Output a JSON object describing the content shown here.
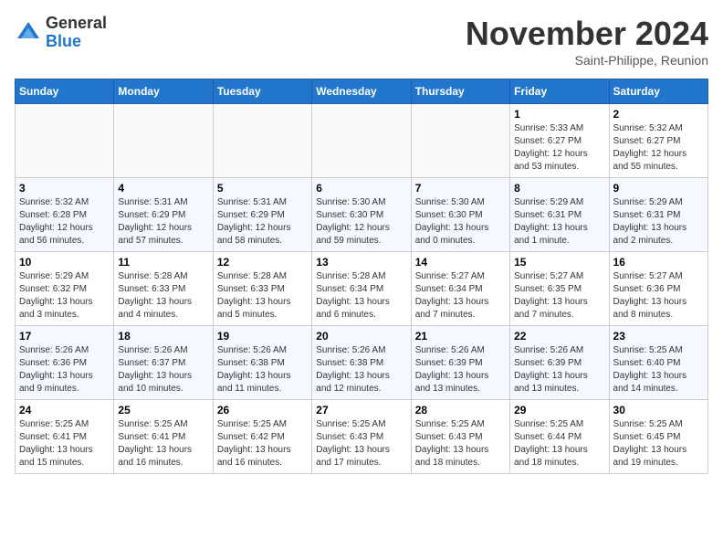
{
  "header": {
    "logo_general": "General",
    "logo_blue": "Blue",
    "month_title": "November 2024",
    "subtitle": "Saint-Philippe, Reunion"
  },
  "weekdays": [
    "Sunday",
    "Monday",
    "Tuesday",
    "Wednesday",
    "Thursday",
    "Friday",
    "Saturday"
  ],
  "weeks": [
    [
      {
        "day": "",
        "info": ""
      },
      {
        "day": "",
        "info": ""
      },
      {
        "day": "",
        "info": ""
      },
      {
        "day": "",
        "info": ""
      },
      {
        "day": "",
        "info": ""
      },
      {
        "day": "1",
        "info": "Sunrise: 5:33 AM\nSunset: 6:27 PM\nDaylight: 12 hours and 53 minutes."
      },
      {
        "day": "2",
        "info": "Sunrise: 5:32 AM\nSunset: 6:27 PM\nDaylight: 12 hours and 55 minutes."
      }
    ],
    [
      {
        "day": "3",
        "info": "Sunrise: 5:32 AM\nSunset: 6:28 PM\nDaylight: 12 hours and 56 minutes."
      },
      {
        "day": "4",
        "info": "Sunrise: 5:31 AM\nSunset: 6:29 PM\nDaylight: 12 hours and 57 minutes."
      },
      {
        "day": "5",
        "info": "Sunrise: 5:31 AM\nSunset: 6:29 PM\nDaylight: 12 hours and 58 minutes."
      },
      {
        "day": "6",
        "info": "Sunrise: 5:30 AM\nSunset: 6:30 PM\nDaylight: 12 hours and 59 minutes."
      },
      {
        "day": "7",
        "info": "Sunrise: 5:30 AM\nSunset: 6:30 PM\nDaylight: 13 hours and 0 minutes."
      },
      {
        "day": "8",
        "info": "Sunrise: 5:29 AM\nSunset: 6:31 PM\nDaylight: 13 hours and 1 minute."
      },
      {
        "day": "9",
        "info": "Sunrise: 5:29 AM\nSunset: 6:31 PM\nDaylight: 13 hours and 2 minutes."
      }
    ],
    [
      {
        "day": "10",
        "info": "Sunrise: 5:29 AM\nSunset: 6:32 PM\nDaylight: 13 hours and 3 minutes."
      },
      {
        "day": "11",
        "info": "Sunrise: 5:28 AM\nSunset: 6:33 PM\nDaylight: 13 hours and 4 minutes."
      },
      {
        "day": "12",
        "info": "Sunrise: 5:28 AM\nSunset: 6:33 PM\nDaylight: 13 hours and 5 minutes."
      },
      {
        "day": "13",
        "info": "Sunrise: 5:28 AM\nSunset: 6:34 PM\nDaylight: 13 hours and 6 minutes."
      },
      {
        "day": "14",
        "info": "Sunrise: 5:27 AM\nSunset: 6:34 PM\nDaylight: 13 hours and 7 minutes."
      },
      {
        "day": "15",
        "info": "Sunrise: 5:27 AM\nSunset: 6:35 PM\nDaylight: 13 hours and 7 minutes."
      },
      {
        "day": "16",
        "info": "Sunrise: 5:27 AM\nSunset: 6:36 PM\nDaylight: 13 hours and 8 minutes."
      }
    ],
    [
      {
        "day": "17",
        "info": "Sunrise: 5:26 AM\nSunset: 6:36 PM\nDaylight: 13 hours and 9 minutes."
      },
      {
        "day": "18",
        "info": "Sunrise: 5:26 AM\nSunset: 6:37 PM\nDaylight: 13 hours and 10 minutes."
      },
      {
        "day": "19",
        "info": "Sunrise: 5:26 AM\nSunset: 6:38 PM\nDaylight: 13 hours and 11 minutes."
      },
      {
        "day": "20",
        "info": "Sunrise: 5:26 AM\nSunset: 6:38 PM\nDaylight: 13 hours and 12 minutes."
      },
      {
        "day": "21",
        "info": "Sunrise: 5:26 AM\nSunset: 6:39 PM\nDaylight: 13 hours and 13 minutes."
      },
      {
        "day": "22",
        "info": "Sunrise: 5:26 AM\nSunset: 6:39 PM\nDaylight: 13 hours and 13 minutes."
      },
      {
        "day": "23",
        "info": "Sunrise: 5:25 AM\nSunset: 6:40 PM\nDaylight: 13 hours and 14 minutes."
      }
    ],
    [
      {
        "day": "24",
        "info": "Sunrise: 5:25 AM\nSunset: 6:41 PM\nDaylight: 13 hours and 15 minutes."
      },
      {
        "day": "25",
        "info": "Sunrise: 5:25 AM\nSunset: 6:41 PM\nDaylight: 13 hours and 16 minutes."
      },
      {
        "day": "26",
        "info": "Sunrise: 5:25 AM\nSunset: 6:42 PM\nDaylight: 13 hours and 16 minutes."
      },
      {
        "day": "27",
        "info": "Sunrise: 5:25 AM\nSunset: 6:43 PM\nDaylight: 13 hours and 17 minutes."
      },
      {
        "day": "28",
        "info": "Sunrise: 5:25 AM\nSunset: 6:43 PM\nDaylight: 13 hours and 18 minutes."
      },
      {
        "day": "29",
        "info": "Sunrise: 5:25 AM\nSunset: 6:44 PM\nDaylight: 13 hours and 18 minutes."
      },
      {
        "day": "30",
        "info": "Sunrise: 5:25 AM\nSunset: 6:45 PM\nDaylight: 13 hours and 19 minutes."
      }
    ]
  ]
}
